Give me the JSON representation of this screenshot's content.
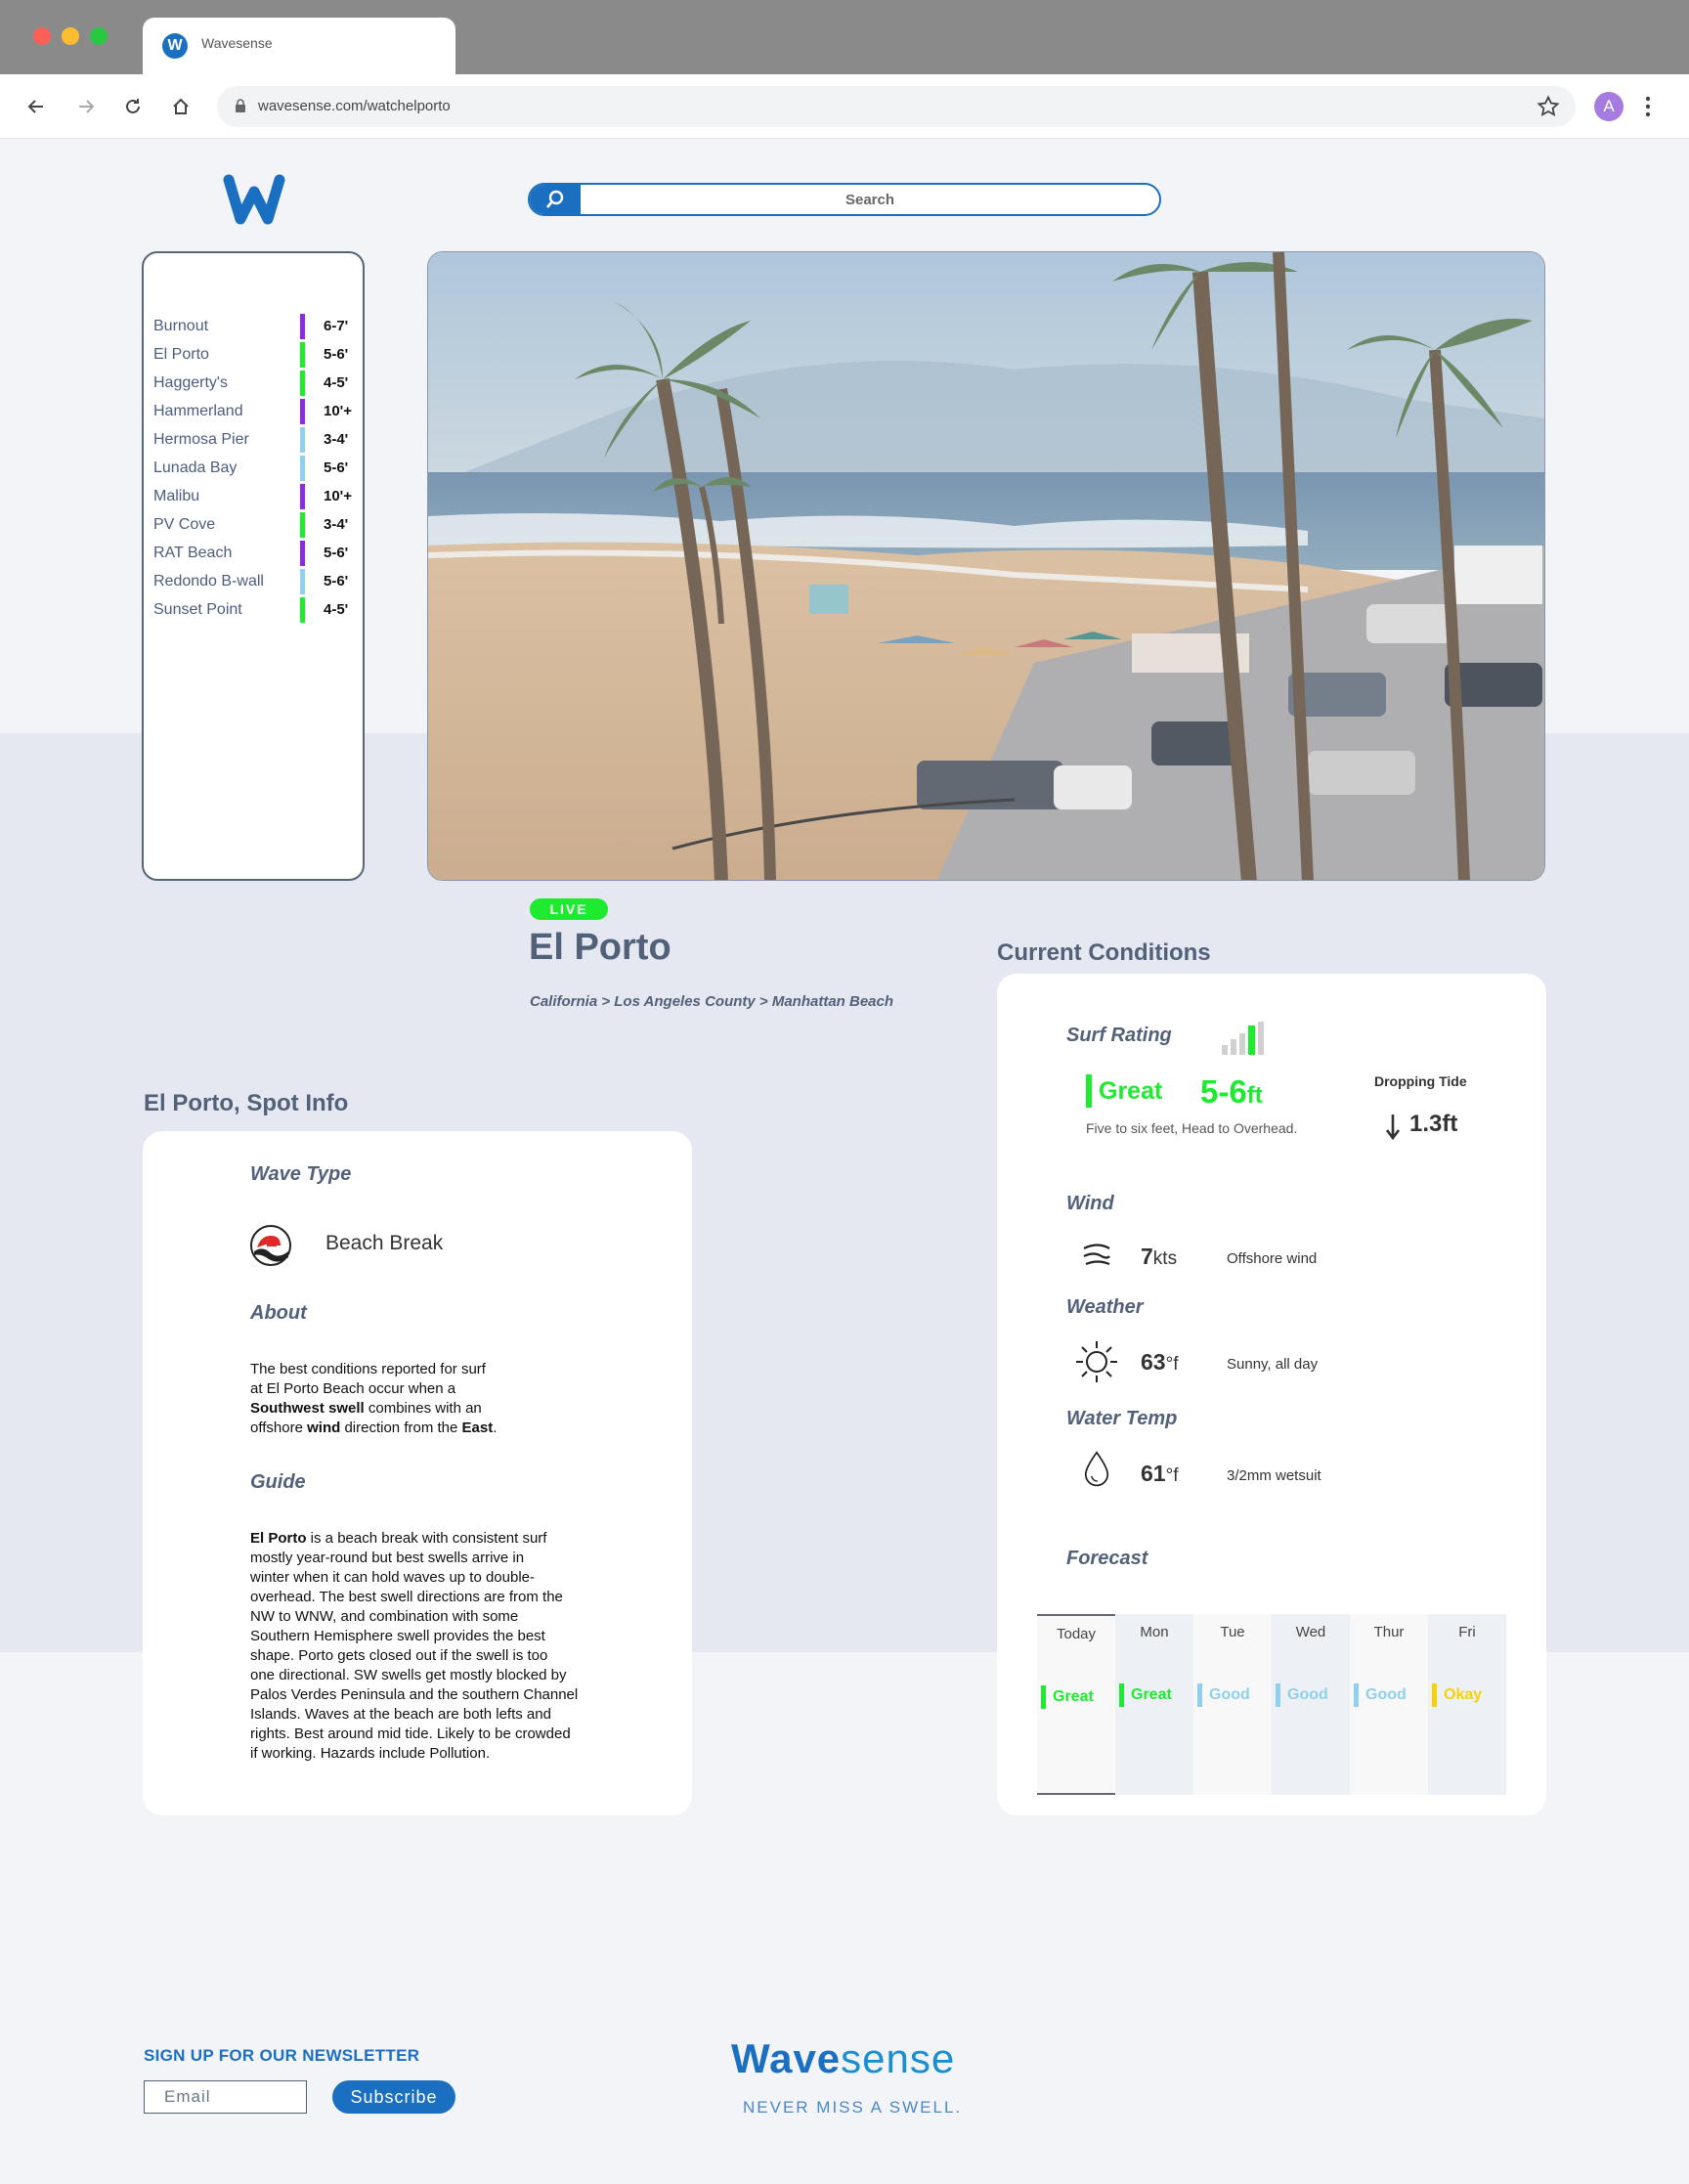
{
  "browser": {
    "tab_title": "Wavesense",
    "tab_icon_letter": "W",
    "url": "wavesense.com/watchelporto",
    "profile_initial": "A"
  },
  "header": {
    "search_placeholder": "Search"
  },
  "spots": [
    {
      "name": "Burnout",
      "height": "6-7'",
      "color": "#8b2be2"
    },
    {
      "name": "El Porto",
      "height": "5-6'",
      "color": "#1eea2f"
    },
    {
      "name": "Haggerty's",
      "height": "4-5'",
      "color": "#1eea2f"
    },
    {
      "name": "Hammerland",
      "height": "10'+",
      "color": "#8b2be2"
    },
    {
      "name": "Hermosa Pier",
      "height": "3-4'",
      "color": "#8fd0ee"
    },
    {
      "name": "Lunada Bay",
      "height": "5-6'",
      "color": "#8fd0ee"
    },
    {
      "name": "Malibu",
      "height": "10'+",
      "color": "#8b2be2"
    },
    {
      "name": "PV Cove",
      "height": "3-4'",
      "color": "#1eea2f"
    },
    {
      "name": "RAT Beach",
      "height": "5-6'",
      "color": "#8b2be2"
    },
    {
      "name": "Redondo B-wall",
      "height": "5-6'",
      "color": "#8fd0ee"
    },
    {
      "name": "Sunset Point",
      "height": "4-5'",
      "color": "#1eea2f"
    }
  ],
  "spot": {
    "live_label": "LIVE",
    "title": "El Porto",
    "breadcrumb": "California > Los Angeles County > Manhattan Beach"
  },
  "spot_info": {
    "section_title": "El Porto, Spot Info",
    "wave_type_heading": "Wave Type",
    "wave_type": "Beach Break",
    "about_heading": "About",
    "about": {
      "l1": "The best conditions reported for surf",
      "l2": "at El Porto Beach occur when a",
      "b1": "Southwest swell",
      "l3": " combines with an",
      "l4": "offshore ",
      "b2": "wind",
      "l5": " direction from the ",
      "b3": "East",
      "l6": "."
    },
    "guide_heading": "Guide",
    "guide": {
      "bold": "El Porto",
      "l1": " is a beach break with consistent surf",
      "lines": [
        "mostly year-round but best swells arrive in",
        "winter when it can hold waves up to double-",
        "overhead. The best swell directions are from the",
        "NW to WNW, and combination with some",
        "Southern Hemisphere swell provides the best",
        "shape. Porto gets closed out if the swell is too",
        "one directional. SW swells get mostly blocked by",
        "Palos Verdes Peninsula and the southern Channel",
        "Islands. Waves at the beach are both lefts and",
        "rights. Best around mid tide. Likely to be crowded",
        "if working. Hazards include Pollution."
      ]
    }
  },
  "conditions": {
    "section_title": "Current Conditions",
    "surf_rating_heading": "Surf Rating",
    "rating": "Great",
    "height_value": "5-6",
    "height_unit": "ft",
    "description": "Five to six feet, Head to Overhead.",
    "tide_label": "Dropping Tide",
    "tide_value": "1.3ft",
    "wind_heading": "Wind",
    "wind_value": "7",
    "wind_unit": "kts",
    "wind_desc": "Offshore wind",
    "weather_heading": "Weather",
    "weather_value": "63",
    "weather_unit": "°f",
    "weather_desc": "Sunny, all day",
    "water_heading": "Water Temp",
    "water_value": "61",
    "water_unit": "°f",
    "water_desc": "3/2mm wetsuit",
    "forecast_heading": "Forecast",
    "forecast": [
      {
        "day": "Today",
        "rating": "Great",
        "color": "#1eea2f"
      },
      {
        "day": "Mon",
        "rating": "Great",
        "color": "#1eea2f"
      },
      {
        "day": "Tue",
        "rating": "Good",
        "color": "#8fd0ee"
      },
      {
        "day": "Wed",
        "rating": "Good",
        "color": "#8fd0ee"
      },
      {
        "day": "Thur",
        "rating": "Good",
        "color": "#8fd0ee"
      },
      {
        "day": "Fri",
        "rating": "Okay",
        "color": "#f5d10a"
      }
    ]
  },
  "footer": {
    "newsletter_title": "SIGN UP FOR OUR NEWSLETTER",
    "email_placeholder": "Email",
    "subscribe_label": "Subscribe",
    "logo_part1": "Wave",
    "logo_part2": "sense",
    "tagline": "NEVER MISS A SWELL."
  },
  "colors": {
    "brand": "#1a6fc0",
    "great": "#1eea2f",
    "good": "#8fd0ee",
    "okay": "#f5d10a",
    "epic": "#8b2be2"
  }
}
